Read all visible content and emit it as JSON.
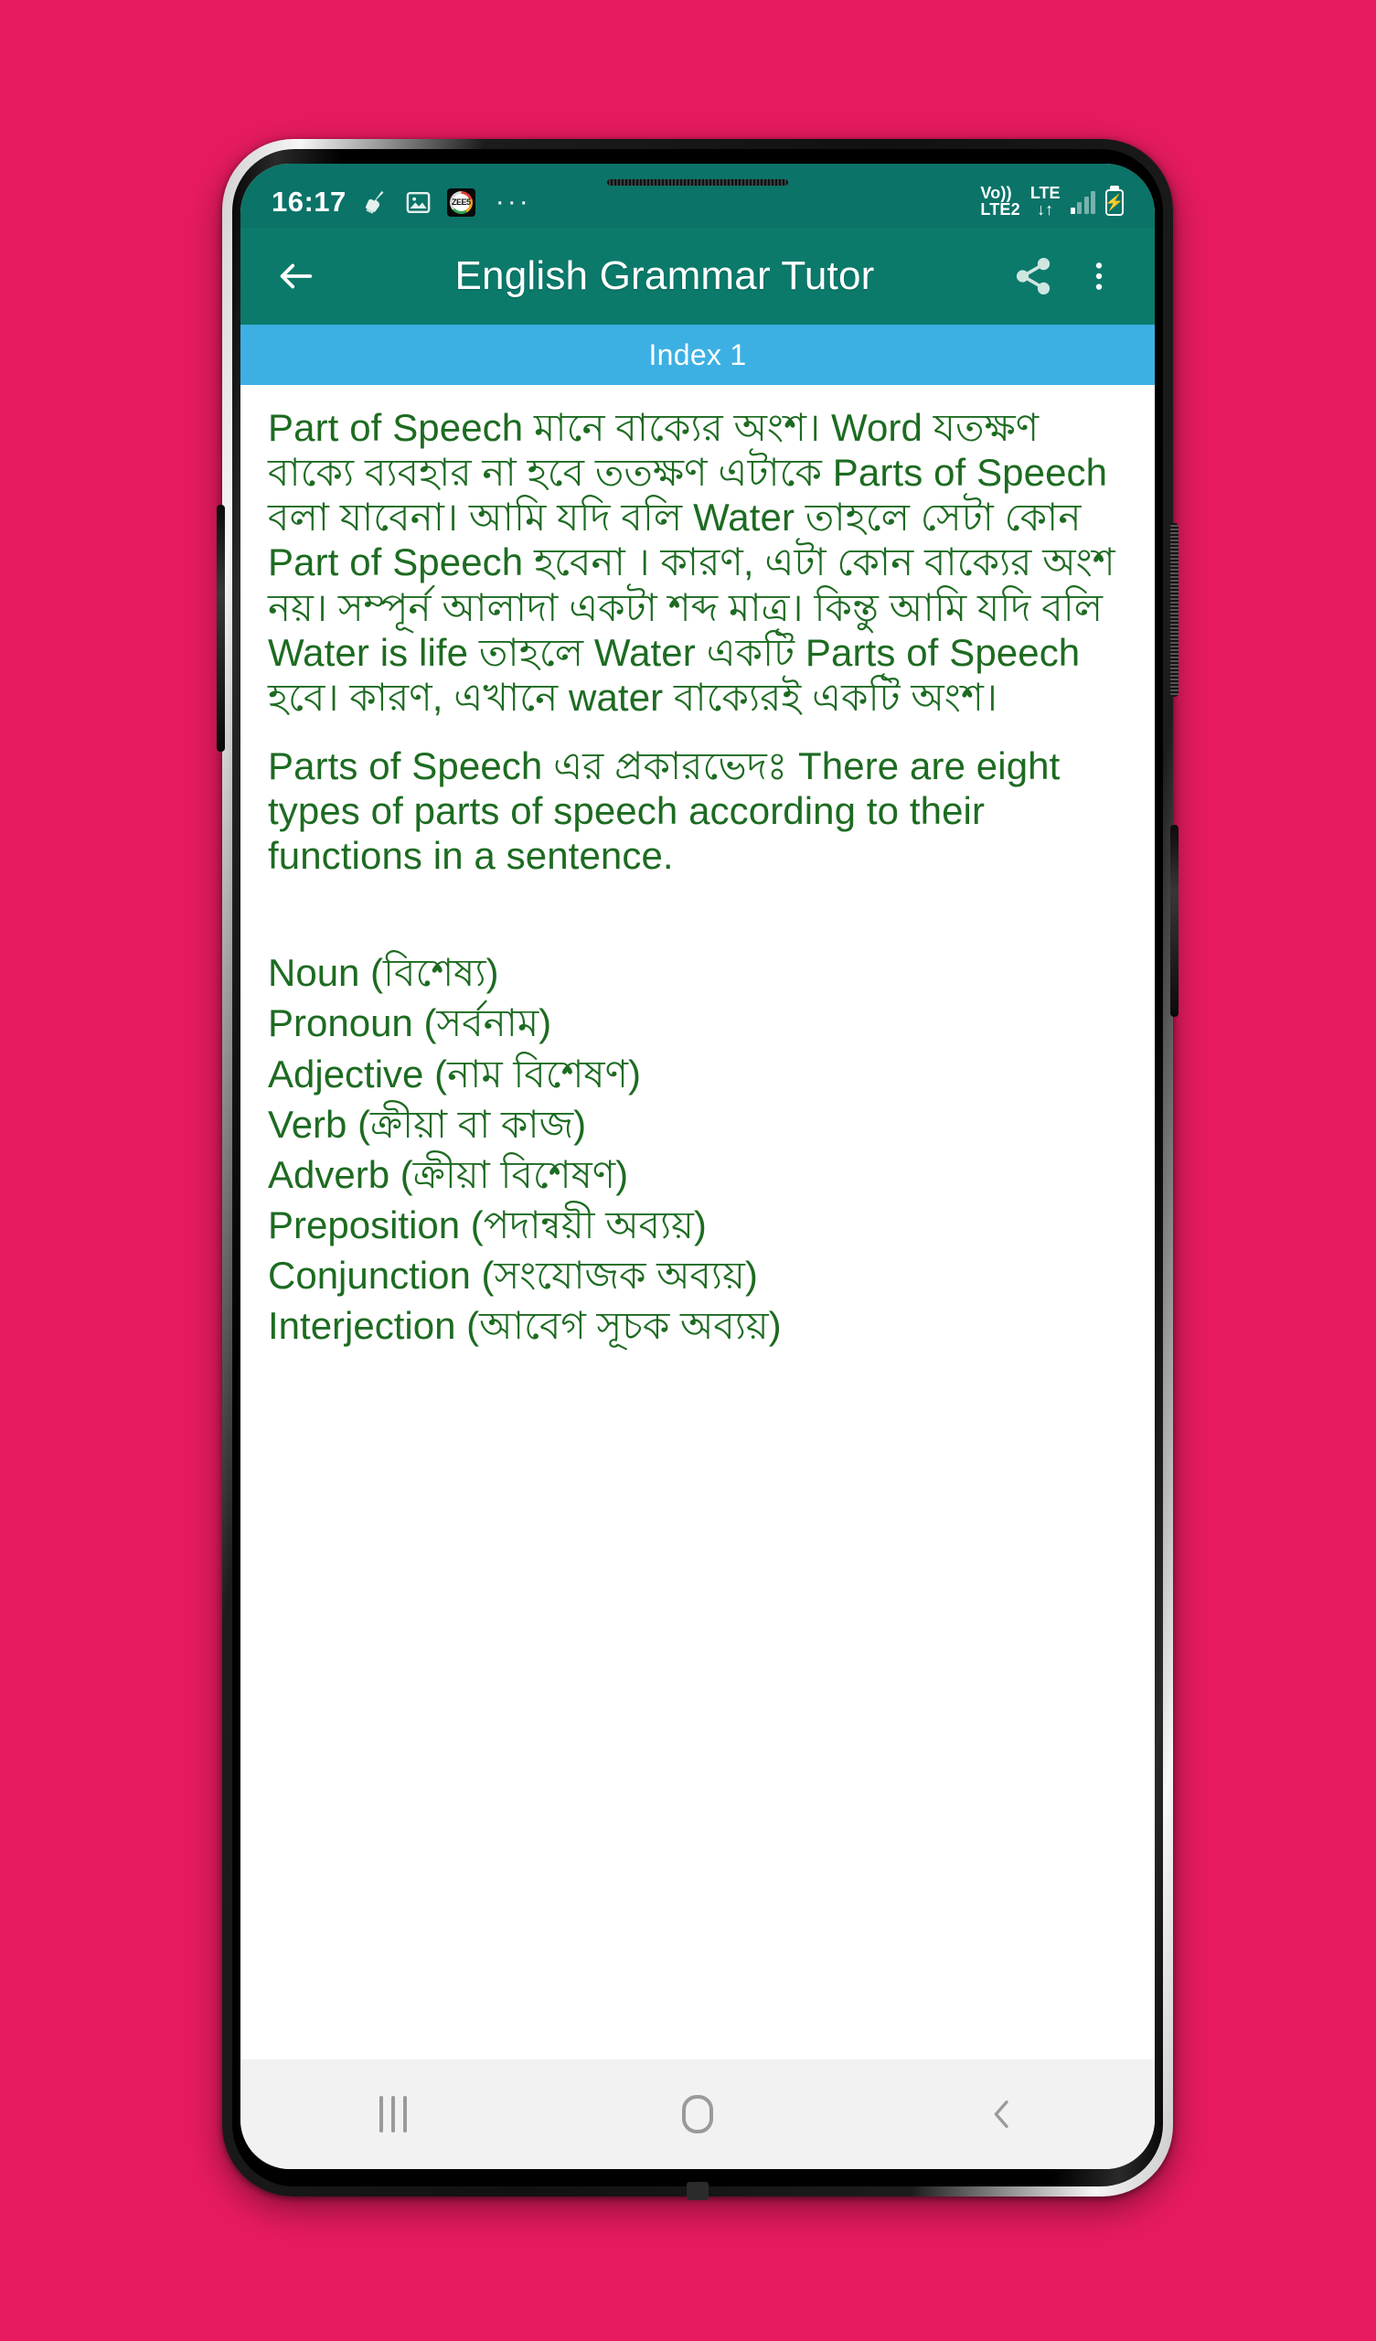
{
  "background": {
    "color": "#E81B60"
  },
  "theme": {
    "statusbar_bg": "#0B7368",
    "appbar_bg": "#0B7A6B",
    "index_bg": "#3DB0E3",
    "text_green": "#1D6B21",
    "navbar_bg": "#F2F2F2"
  },
  "status_bar": {
    "clock": "16:17",
    "icons_left": [
      "broom-icon",
      "photo-icon",
      "zee5-icon",
      "overflow-dots-icon"
    ],
    "zee5_label": "ZEE5",
    "overflow_dots": "···",
    "volte_label": "Vo))",
    "sim_label": "LTE2",
    "network_label": "LTE",
    "data_arrows": "↓↑",
    "icons_right": [
      "signal-bars-icon",
      "battery-charging-icon"
    ]
  },
  "app_bar": {
    "back_icon": "arrow-left-icon",
    "title": "English Grammar Tutor",
    "share_icon": "share-icon",
    "menu_icon": "overflow-menu-icon"
  },
  "index_tab": {
    "label": "Index 1"
  },
  "content": {
    "paragraph_1": "Part of Speech মানে বাক্যের অংশ। Word যতক্ষণ বাক্যে ব্যবহার না হবে ততক্ষণ এটাকে Parts of Speech বলা যাবেনা। আমি যদি বলি Water তাহলে সেটা কোন Part of Speech হবেনা । কারণ, এটা কোন বাক্যের অংশ নয়। সম্পূর্ন আলাদা একটা শব্দ মাত্র। কিন্তু আমি যদি বলি Water is life তাহলে Water একটি Parts of Speech হবে। কারণ, এখানে water বাক্যেরই একটি অংশ।",
    "paragraph_2": "Parts of Speech এর প্রকারভেদঃ There are eight types of parts of speech according to their functions in a sentence.",
    "list": [
      "Noun (বিশেষ্য)",
      "Pronoun (সর্বনাম)",
      "Adjective (নাম বিশেষণ)",
      "Verb (ক্রীয়া বা কাজ)",
      "Adverb (ক্রীয়া বিশেষণ)",
      "Preposition (পদান্বয়ী অব্যয়)",
      "Conjunction (সংযোজক অব্যয়)",
      "Interjection (আবেগ সূচক অব্যয়)"
    ]
  },
  "nav_bar": {
    "recents_icon": "recents-icon",
    "home_icon": "home-icon",
    "back_icon": "back-chevron-icon"
  }
}
